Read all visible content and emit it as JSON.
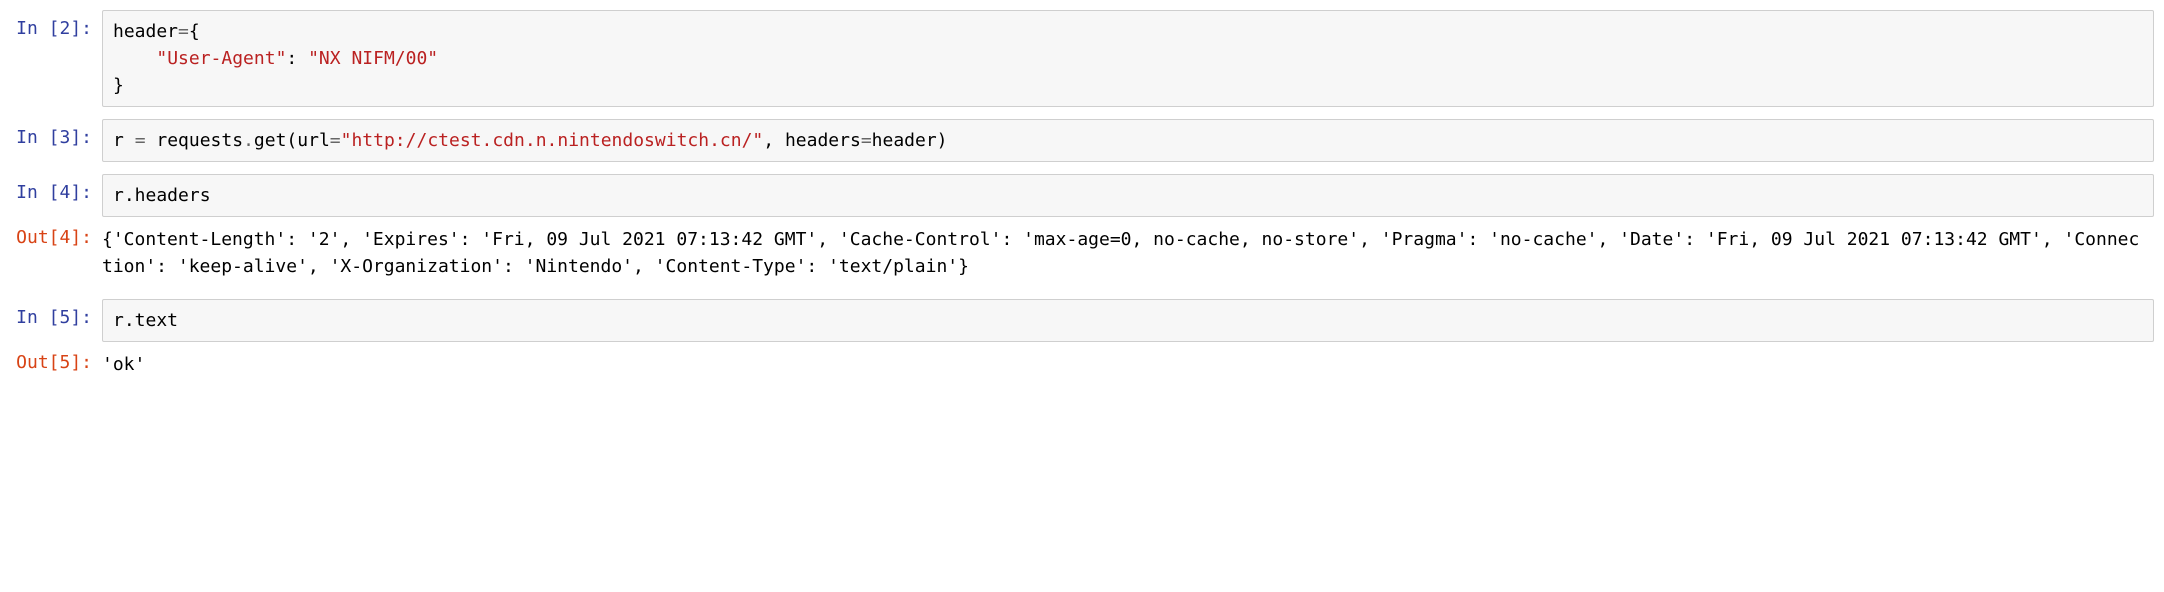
{
  "cells": {
    "c2": {
      "in_prompt": "In [2]:",
      "code": {
        "l1a": "header",
        "l1b": "=",
        "l1c": "{",
        "l2a": "    ",
        "l2b": "\"User-Agent\"",
        "l2c": ": ",
        "l2d": "\"NX NIFM/00\"",
        "l3a": "}"
      }
    },
    "c3": {
      "in_prompt": "In [3]:",
      "code": {
        "a": "r ",
        "b": "=",
        "c": " requests",
        "d": ".",
        "e": "get(url",
        "f": "=",
        "g": "\"http://ctest.cdn.n.nintendoswitch.cn/\"",
        "h": ", headers",
        "i": "=",
        "j": "header)"
      }
    },
    "c4": {
      "in_prompt": "In [4]:",
      "code": "r.headers",
      "out_prompt": "Out[4]:",
      "output": "{'Content-Length': '2', 'Expires': 'Fri, 09 Jul 2021 07:13:42 GMT', 'Cache-Control': 'max-age=0, no-cache, no-store', 'Pragma': 'no-cache', 'Date': 'Fri, 09 Jul 2021 07:13:42 GMT', 'Connection': 'keep-alive', 'X-Organization': 'Nintendo', 'Content-Type': 'text/plain'}"
    },
    "c5": {
      "in_prompt": "In [5]:",
      "code": "r.text",
      "out_prompt": "Out[5]:",
      "output": "'ok'"
    }
  }
}
